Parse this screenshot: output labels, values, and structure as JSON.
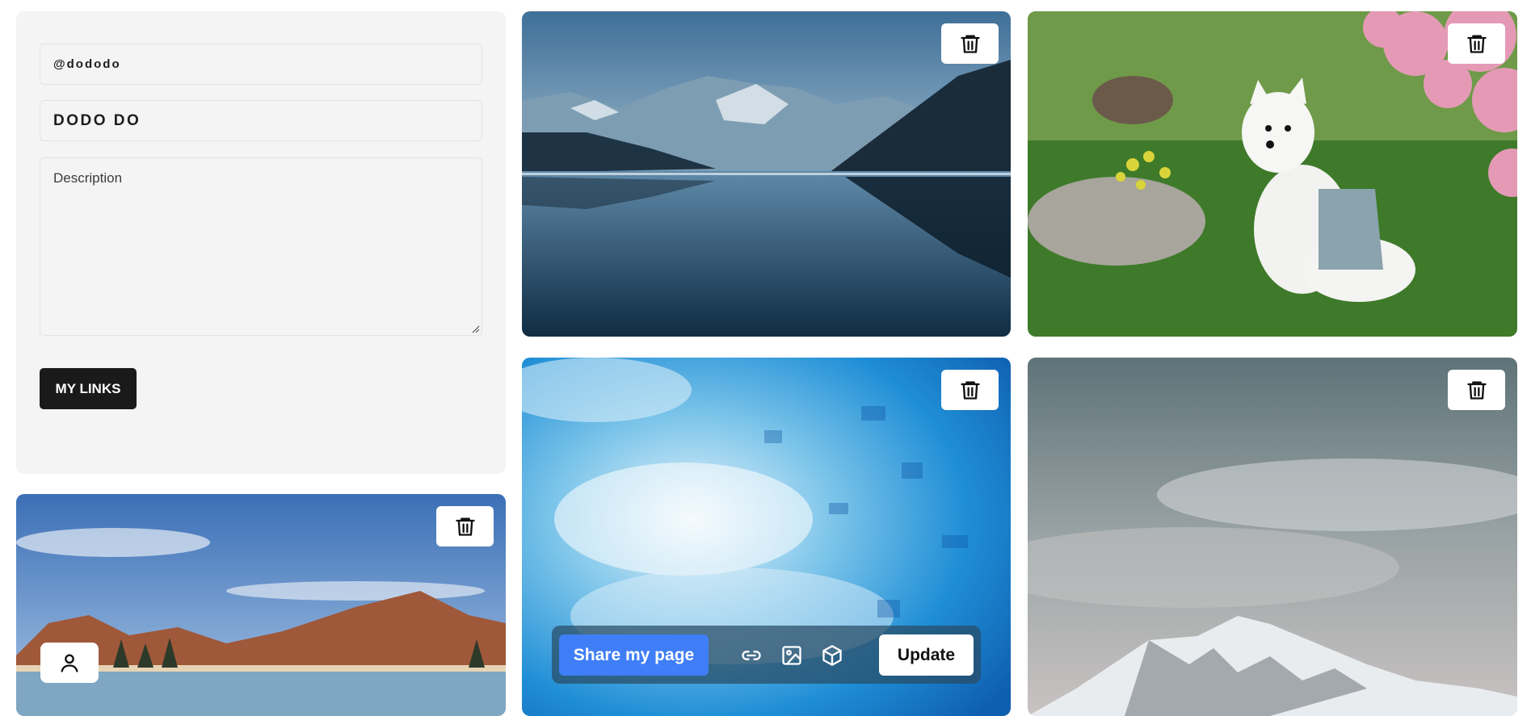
{
  "profile": {
    "handle": "@dododo",
    "name": "DODO DO",
    "description_placeholder": "Description",
    "links_button": "MY LINKS"
  },
  "tiles": [
    {
      "subject": "mountain lake reflection",
      "action_icon": "trash-icon"
    },
    {
      "subject": "white dog under pink blossoms",
      "action_icon": "trash-icon"
    },
    {
      "subject": "blue abstract crystal texture",
      "action_icon": "trash-icon"
    },
    {
      "subject": "snowy peak under grey sky",
      "action_icon": "trash-icon"
    },
    {
      "subject": "alpine lake with autumn mountains",
      "action_icon": "trash-icon"
    }
  ],
  "toolbar": {
    "share_label": "Share my page",
    "update_label": "Update",
    "icons": [
      "link-icon",
      "image-icon",
      "cube-icon"
    ]
  },
  "avatar_icon": "user-icon",
  "colors": {
    "accent": "#3f7ef6",
    "card_bg": "#f4f4f4",
    "dark_button": "#1a1a1a"
  }
}
